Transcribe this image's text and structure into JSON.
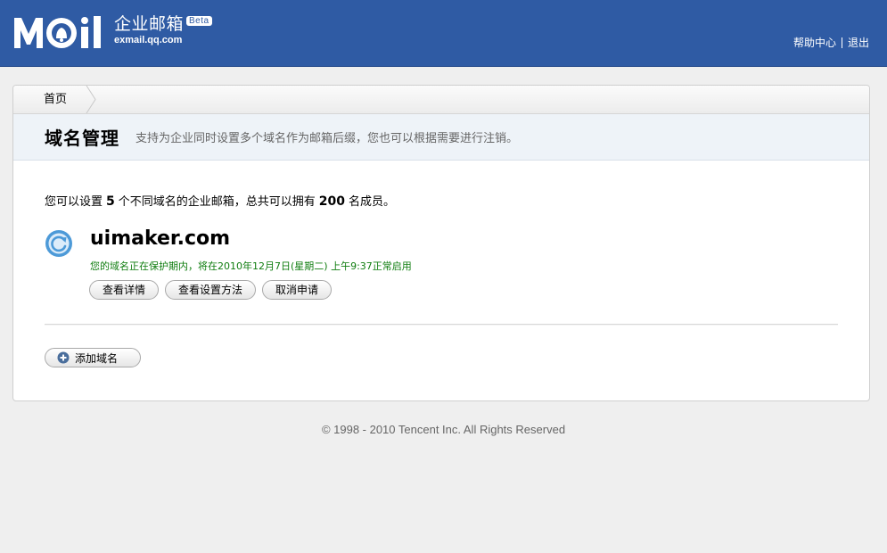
{
  "header": {
    "logo_text": "MOil",
    "product_name": "企业邮箱",
    "beta_badge": "Beta",
    "url": "exmail.qq.com",
    "links": {
      "help": "帮助中心",
      "logout": "退出"
    }
  },
  "breadcrumb": {
    "home": "首页"
  },
  "page": {
    "title": "域名管理",
    "description": "支持为企业同时设置多个域名作为邮箱后缀，您也可以根据需要进行注销。"
  },
  "quota": {
    "prefix": "您可以设置",
    "domains": "5",
    "middle": "个不同域名的企业邮箱，总共可以拥有",
    "members": "200",
    "suffix": "名成员。"
  },
  "domain": {
    "name": "uimaker.com",
    "status": "您的域名正在保护期内，将在2010年12月7日(星期二) 上午9:37正常启用",
    "buttons": {
      "details": "查看详情",
      "setup": "查看设置方法",
      "cancel": "取消申请"
    }
  },
  "add_domain": {
    "label": "添加域名"
  },
  "footer": {
    "copyright": "© 1998 - 2010 Tencent Inc. All Rights Reserved"
  },
  "colors": {
    "header_bg": "#2f5ba4",
    "status_green": "#0f7d0f",
    "title_bar_bg": "#eef3f8",
    "icon_blue": "#4d9ad8"
  }
}
